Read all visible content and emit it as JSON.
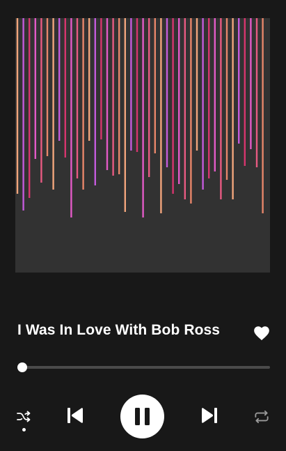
{
  "track": {
    "title": "I Was In Love With Bob Ross",
    "liked": true,
    "progress": 0.02,
    "shuffle_on": true
  },
  "colors": {
    "background": "#181818",
    "artwork_bg": "#323232",
    "accent": "#ffffff",
    "bar_palette": [
      "#e35ac7",
      "#e85a82",
      "#e8866a",
      "#f2a57c",
      "#c45bdc",
      "#d7356e"
    ]
  },
  "controls": {
    "shuffle": "shuffle-icon",
    "previous": "skip-previous-icon",
    "play_pause": "pause-icon",
    "next": "skip-next-icon",
    "repeat": "repeat-icon",
    "like": "heart-icon"
  }
}
